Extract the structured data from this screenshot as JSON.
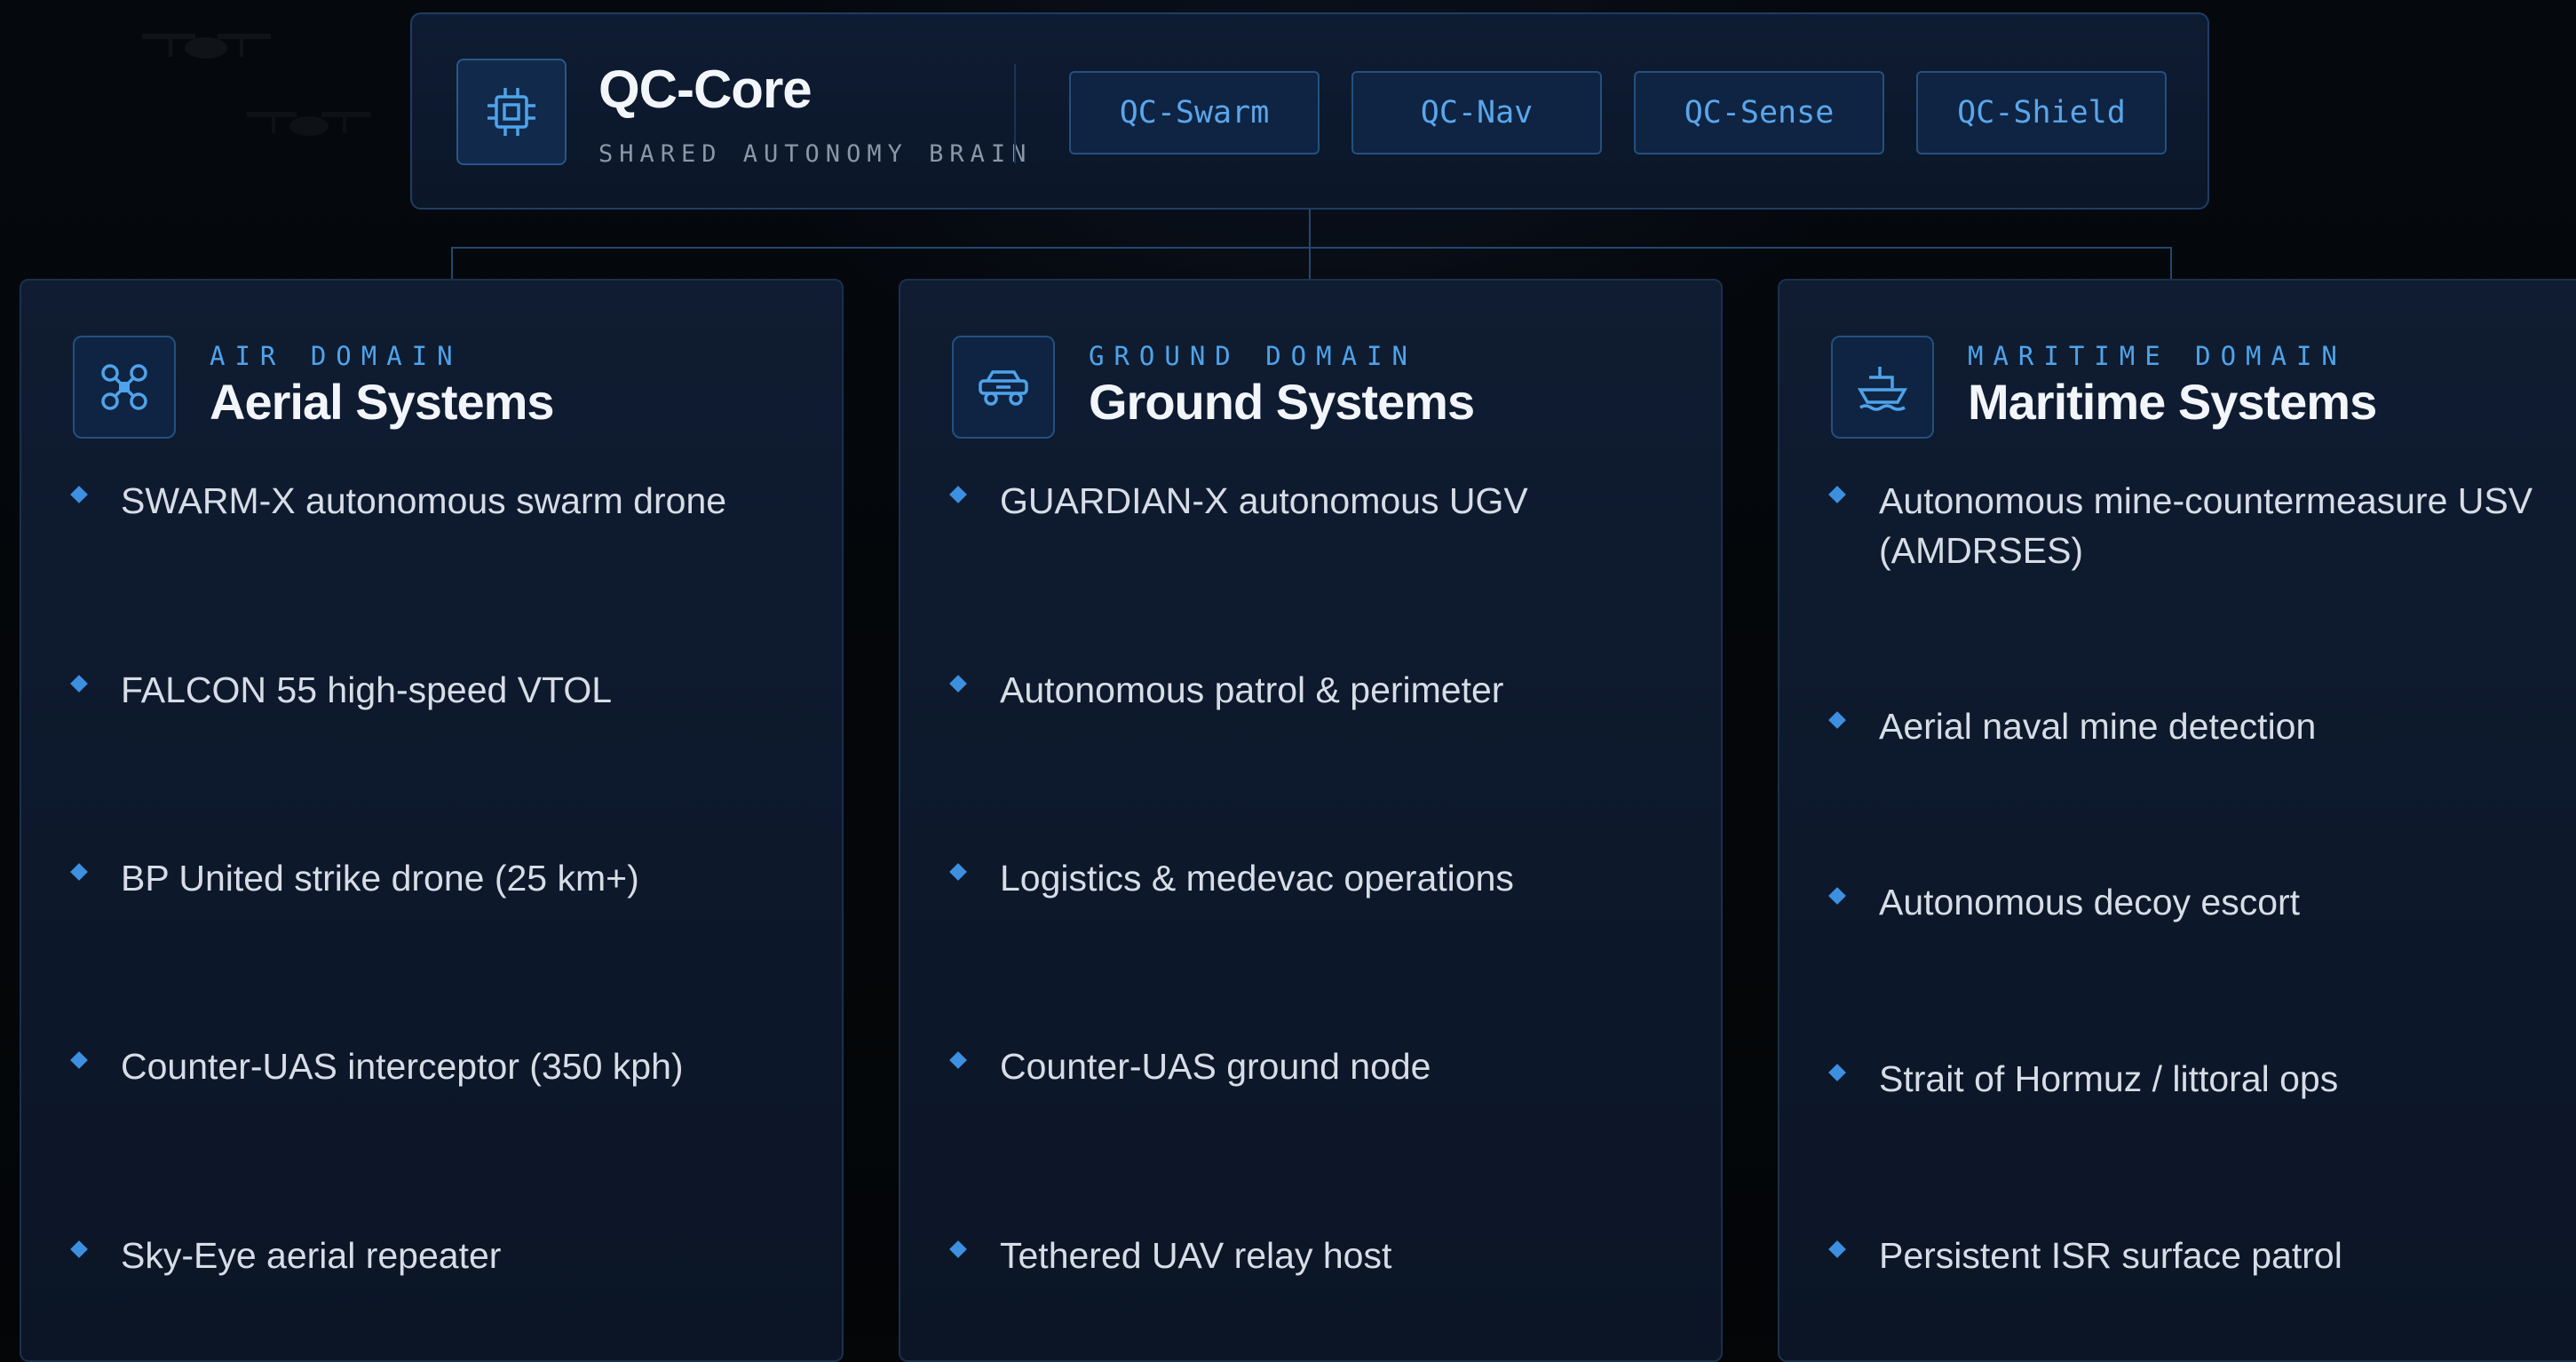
{
  "core": {
    "icon": "cpu-chip-icon",
    "title": "QC-Core",
    "subtitle": "SHARED AUTONOMY BRAIN",
    "modules": [
      "QC-Swarm",
      "QC-Nav",
      "QC-Sense",
      "QC-Shield"
    ]
  },
  "domains": [
    {
      "icon": "drone-icon",
      "kicker": "AIR DOMAIN",
      "title": "Aerial Systems",
      "items": [
        "SWARM-X autonomous swarm drone",
        "FALCON 55 high-speed VTOL",
        "BP United strike drone (25 km+)",
        "Counter-UAS interceptor (350 kph)",
        "Sky-Eye aerial repeater"
      ]
    },
    {
      "icon": "ground-vehicle-icon",
      "kicker": "GROUND DOMAIN",
      "title": "Ground Systems",
      "items": [
        "GUARDIAN-X autonomous UGV",
        "Autonomous patrol & perimeter",
        "Logistics & medevac operations",
        "Counter-UAS ground node",
        "Tethered UAV relay host"
      ]
    },
    {
      "icon": "ship-icon",
      "kicker": "MARITIME DOMAIN",
      "title": "Maritime Systems",
      "items": [
        "Autonomous mine-countermeasure USV (AMDRSES)",
        "Aerial naval mine detection",
        "Autonomous decoy escort",
        "Strait of Hormuz / littoral ops",
        "Persistent ISR surface patrol"
      ]
    }
  ],
  "colors": {
    "accent": "#4fa3ea",
    "bullet": "#3d8fe0",
    "panel_border": "#1f3d64",
    "background": "#040608"
  }
}
